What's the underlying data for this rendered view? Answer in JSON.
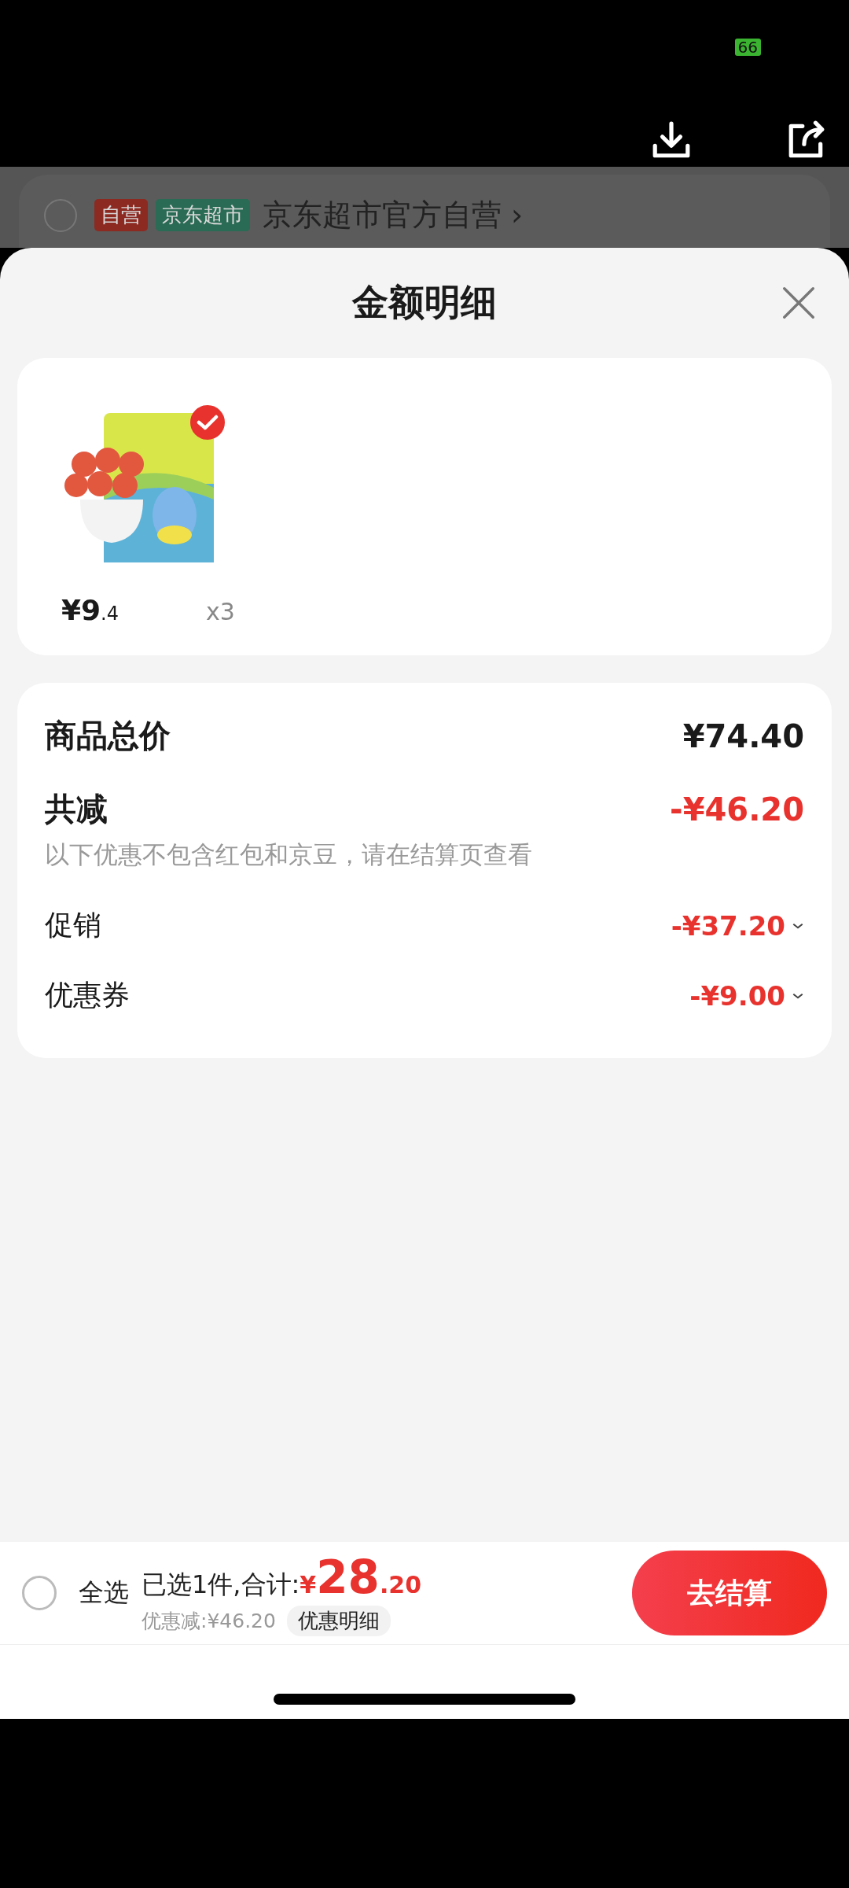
{
  "status_bar": {
    "battery": "66"
  },
  "toolbar": {
    "actions": [
      {
        "kind": "download"
      },
      {
        "kind": "share"
      }
    ]
  },
  "background_store": {
    "selected": false,
    "tags": [
      {
        "label": "自营",
        "color": "#8c2a22"
      },
      {
        "label": "京东超市",
        "color": "#2a6b55"
      }
    ],
    "name": "京东超市官方自营",
    "chevron": "›"
  },
  "sheet": {
    "title": "金额明细"
  },
  "products": [
    {
      "kind": "picture",
      "selected": true,
      "currency": "¥",
      "price_int": "9",
      "price_dec": ".4",
      "quantity": "x3"
    }
  ],
  "summary": {
    "total": {
      "label": "商品总价",
      "value": "¥74.40"
    },
    "discount": {
      "label": "共减",
      "value": "-¥46.20",
      "note": "以下优惠不包含红包和京豆，请在结算页查看"
    },
    "items": [
      {
        "label": "促销",
        "value": "-¥37.20"
      },
      {
        "label": "优惠券",
        "value": "-¥9.00"
      }
    ]
  },
  "bottom_bar": {
    "select_all": {
      "label": "全选",
      "checked": false
    },
    "selected_text": "已选1件,合计:",
    "currency": "¥",
    "total_int": "28",
    "total_dec": ".20",
    "discount_text": "优惠减:¥46.20",
    "details_button": "优惠明细",
    "checkout_button": "去结算"
  }
}
